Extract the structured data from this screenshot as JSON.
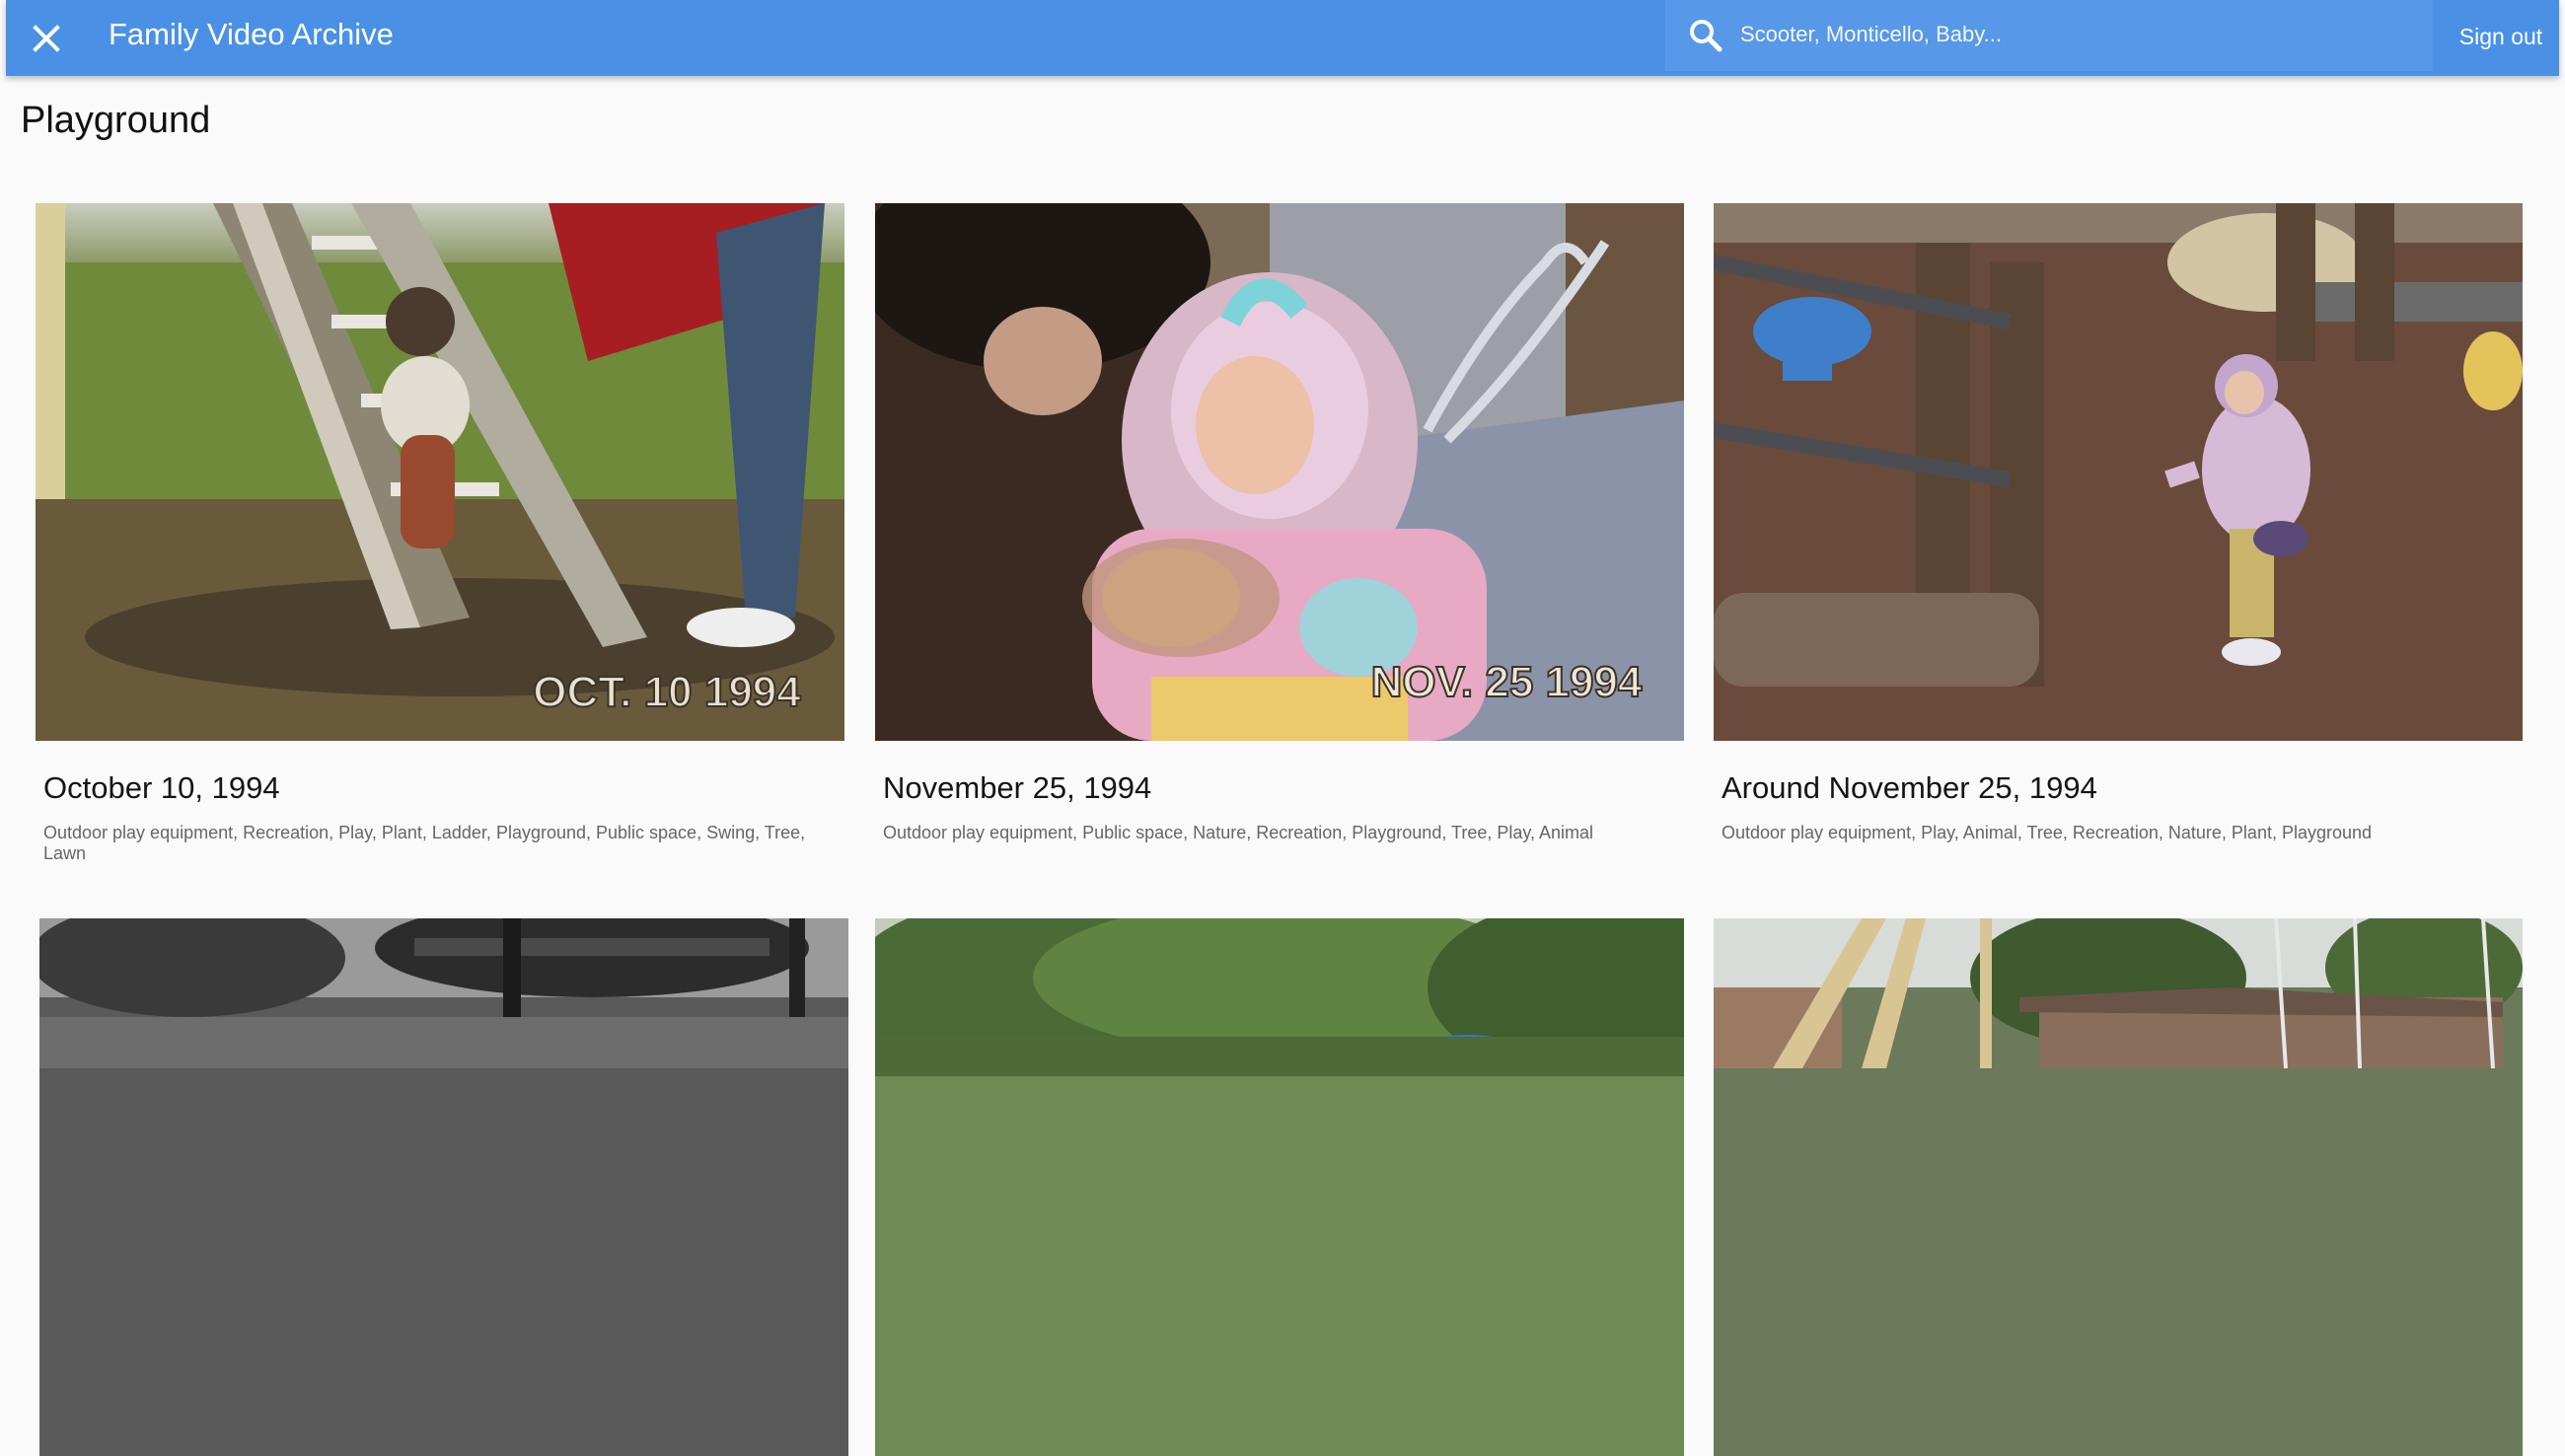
{
  "appbar": {
    "title": "Family Video Archive",
    "close_icon": "close-icon",
    "search_icon": "search-icon",
    "search_placeholder": "Scooter, Monticello, Baby...",
    "search_value": "",
    "signout_label": "Sign out",
    "color": "#4a91e6"
  },
  "page": {
    "title": "Playground"
  },
  "videos": [
    {
      "title": "October 10, 1994",
      "tags": "Outdoor play equipment, Recreation, Play, Plant, Ladder, Playground, Public space, Swing, Tree, Lawn",
      "stamp": "OCT. 10 1994"
    },
    {
      "title": "November 25, 1994",
      "tags": "Outdoor play equipment, Public space, Nature, Recreation, Playground, Tree, Play, Animal",
      "stamp": "NOV. 25 1994"
    },
    {
      "title": "Around November 25, 1994",
      "tags": "Outdoor play equipment, Play, Animal, Tree, Recreation, Nature, Plant, Playground",
      "stamp": ""
    },
    {
      "title": "",
      "tags": "",
      "stamp": ""
    },
    {
      "title": "",
      "tags": "",
      "stamp": ""
    },
    {
      "title": "",
      "tags": "",
      "stamp": ""
    }
  ]
}
